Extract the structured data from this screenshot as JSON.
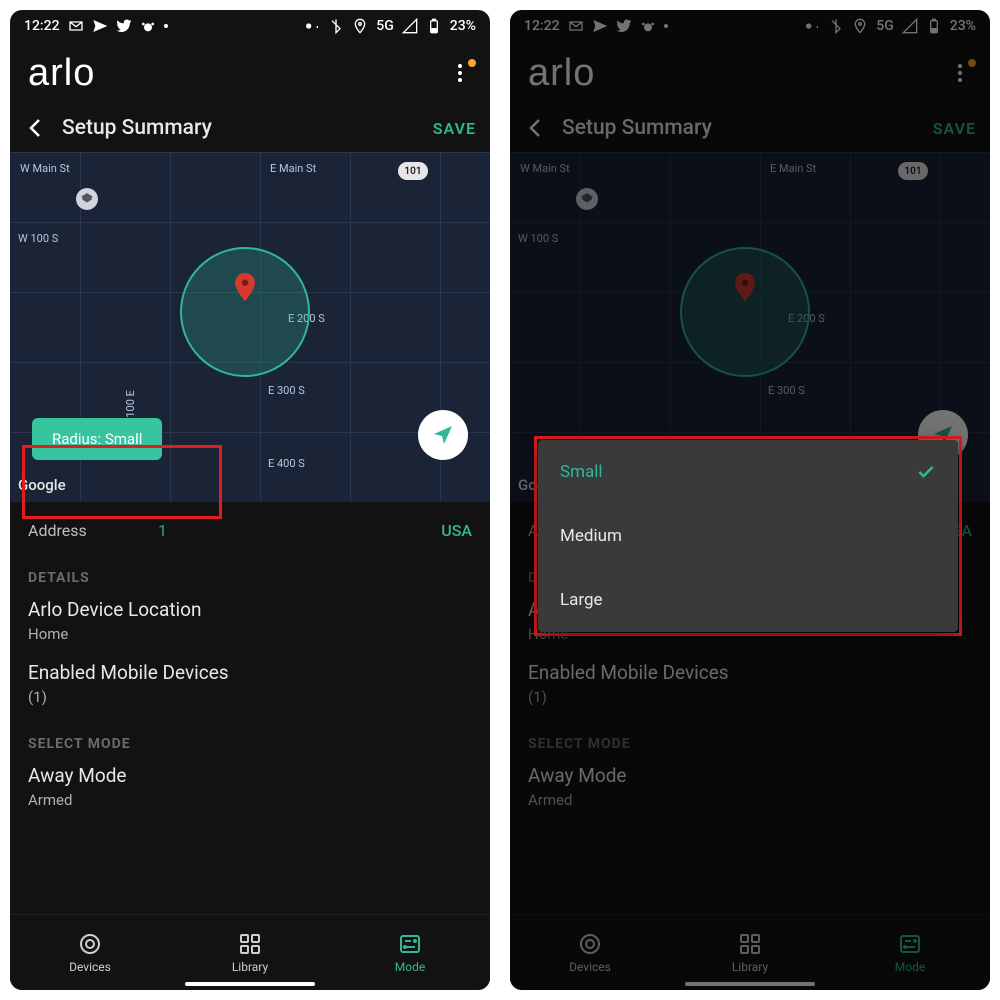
{
  "statusbar": {
    "time": "12:22",
    "network": "5G",
    "battery": "23%"
  },
  "brand": "arlo",
  "header": {
    "title": "Setup Summary",
    "save": "SAVE"
  },
  "map": {
    "streets": {
      "w_main": "W Main St",
      "e_main": "E Main St",
      "w_100_s": "W 100 S",
      "e_200_s": "E 200 S",
      "e_300_s": "E 300 S",
      "e_400_s": "E 400 S",
      "s_100_e": "S 100 E"
    },
    "route_badge": "101",
    "radius_button": "Radius: Small",
    "attribution": "Google"
  },
  "address": {
    "label": "Address",
    "value": "1",
    "suffix": "USA"
  },
  "details": {
    "heading": "DETAILS",
    "device_location_title": "Arlo Device Location",
    "device_location_value": "Home",
    "enabled_devices_title": "Enabled Mobile Devices",
    "enabled_devices_value": "(1)"
  },
  "select_mode": {
    "heading": "SELECT MODE",
    "away_title": "Away Mode",
    "away_value": "Armed"
  },
  "nav": {
    "devices": "Devices",
    "library": "Library",
    "mode": "Mode"
  },
  "radius_menu": {
    "small": "Small",
    "medium": "Medium",
    "large": "Large"
  }
}
